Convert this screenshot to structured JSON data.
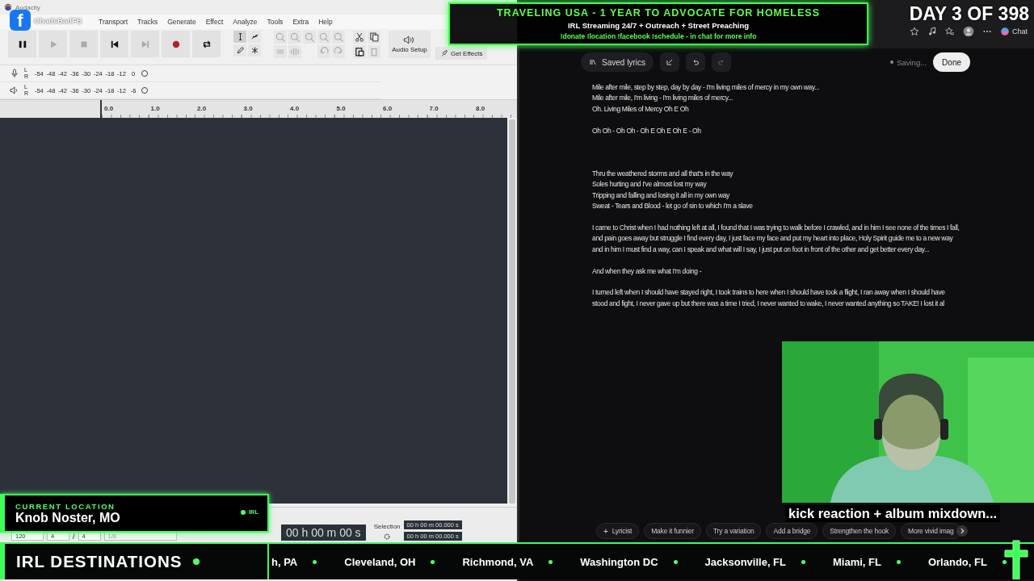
{
  "audacity": {
    "title": "Audacity",
    "menu": [
      "Transport",
      "Tracks",
      "Generate",
      "Effect",
      "Analyze",
      "Tools",
      "Extra",
      "Help"
    ],
    "audio_setup": "Audio Setup",
    "get_effects": "Get Effects",
    "record_meter": {
      "channels": [
        "L",
        "R"
      ],
      "ticks": [
        "-54",
        "-48",
        "-42",
        "-36",
        "-30",
        "-24",
        "-18",
        "-12",
        "0"
      ]
    },
    "play_meter": {
      "channels": [
        "L",
        "R"
      ],
      "ticks": [
        "-54",
        "-48",
        "-42",
        "-36",
        "-30",
        "-24",
        "-18",
        "-12",
        "-6"
      ]
    },
    "ruler": [
      "0.0",
      "1.0",
      "2.0",
      "3.0",
      "4.0",
      "5.0",
      "6.0",
      "7.0",
      "8.0"
    ],
    "bottom": {
      "tempo": "120",
      "beats": "4",
      "slash": "/",
      "beat_unit": "4",
      "snap": "1/8",
      "time": "00 h 00 m 00 s",
      "selection_label": "Selection",
      "selection": [
        "00 h 00 m 00.000 s",
        "00 h 00 m 00.000 s"
      ]
    }
  },
  "browser": {
    "chat": "Chat"
  },
  "editor": {
    "saved_lyrics": "Saved lyrics",
    "status": "Saving...",
    "done": "Done",
    "lyrics": [
      [
        "Mile after mile, step by step, day by day - I'm living miles of mercy in my own way...",
        "Mile after mile, I'm living - I'm living miles of mercy...",
        "Oh. Living Miles of Mercy Oh E Oh"
      ],
      [
        "Oh Oh - Oh Oh - Oh E Oh E Oh E - Oh"
      ],
      [
        "Thru the weathered storms and all that's in the way",
        "Soles hurting and I've almost lost my way",
        "Tripping and falling and losing it all in my own way",
        "Sweat - Tears and Blood - let go of sin to which I'm a slave"
      ],
      [
        "I came to Christ when I had nothing left at all, I found that I was trying to walk before I crawled, and in him I see none of the times I fall, and pain goes away but struggle I find every day, I just face my face and put my heart into place, Holy Spirit guide me to a new way and in him I must find a way, can I speak and what will I say, I just put on foot in front of the other and get better every day..."
      ],
      [
        "And when they ask me what I'm doing -"
      ],
      [
        "I turned left when I should have stayed right, I took trains to here when I should have took a flight, I ran away when I should have stood and fight, I never gave up but there was a time I tried, I never wanted to wake, I never wanted anything so TAKE! I lost it al"
      ]
    ],
    "suggestions": [
      {
        "prefix": "+",
        "label": "Lyricist"
      },
      {
        "label": "Make it funnier"
      },
      {
        "label": "Try a variation"
      },
      {
        "label": "Add a bridge"
      },
      {
        "label": "Strengthen the hook"
      },
      {
        "label": "More vivid imag"
      }
    ]
  },
  "webcam": {
    "kind": "picture",
    "caption": "kick reaction + album mixdown..."
  },
  "overlay": {
    "banner": {
      "title": "TRAVELING USA - 1 YEAR TO ADVOCATE FOR HOMELESS",
      "subtitle": "IRL Streaming 24/7 + Outreach + Street Preaching",
      "commands": "!donate !location !facebook !schedule - in chat for more info"
    },
    "day_counter": "DAY 3 OF 398",
    "facebook": {
      "logo": "f",
      "handle": "ChadsBadFB"
    },
    "location": {
      "label": "CURRENT LOCATION",
      "place": "Knob Noster, MO",
      "badge": "IRL"
    },
    "ticker": {
      "title": "IRL DESTINATIONS",
      "items": [
        "h, PA",
        "Cleveland, OH",
        "Richmond, VA",
        "Washington DC",
        "Jacksonville, FL",
        "Miami, FL",
        "Orlando, FL"
      ]
    }
  }
}
